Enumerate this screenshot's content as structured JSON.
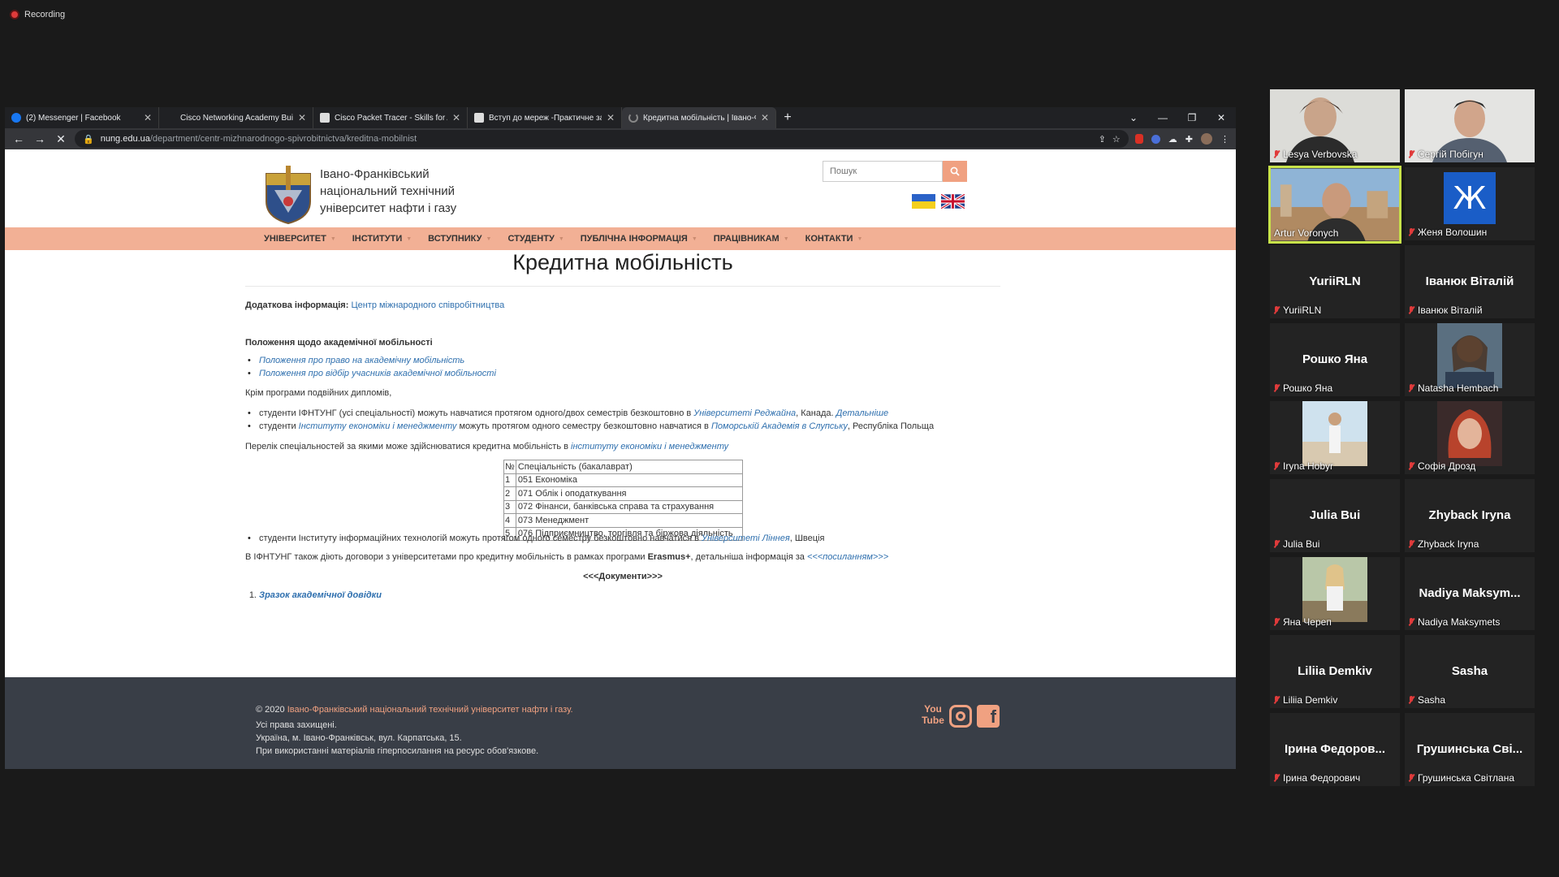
{
  "meeting": {
    "recording_label": "Recording"
  },
  "browser": {
    "tabs": [
      {
        "title": "(2) Messenger | Facebook"
      },
      {
        "title": "Cisco Networking Academy Builds"
      },
      {
        "title": "Cisco Packet Tracer - Skills for All"
      },
      {
        "title": "Вступ до мереж -Практичне за"
      },
      {
        "title": "Кредитна мобільність | Івано-Ф"
      }
    ],
    "url_host": "nung.edu.ua",
    "url_path": "/department/centr-mizhnarodnogo-spivrobitnictva/kreditna-mobilnist"
  },
  "site": {
    "name_line1": "Івано-Франківський",
    "name_line2": "національний технічний",
    "name_line3": "університет нафти і газу",
    "search_placeholder": "Пошук",
    "nav": [
      "УНІВЕРСИТЕТ",
      "ІНСТИТУТИ",
      "ВСТУПНИКУ",
      "СТУДЕНТУ",
      "ПУБЛІЧНА ІНФОРМАЦІЯ",
      "ПРАЦІВНИКАМ",
      "КОНТАКТИ"
    ]
  },
  "content": {
    "title": "Кредитна мобільність",
    "extra_label": "Додаткова інформація:",
    "extra_link": "Центр міжнародного співробітництва",
    "section_title": "Положення щодо академічної мобільності",
    "regulations": [
      "Положення про право на академічну мобільність",
      "Положення про відбір учасників академічної мобільності"
    ],
    "paragraph1": "Крім програми подвійних дипломів,",
    "program1": {
      "text1": "студенти ІФНТУНГ (усі спеціальності) можуть навчатися протягом одного/двох семестрів безкоштовно в",
      "link1": "Університеті Реджайна",
      "text2": ", Канада.",
      "link2": "Детальніше"
    },
    "program2": {
      "text1": "студенти",
      "link1": "Інституту економіки і менеджменту",
      "text2": "можуть протягом одного семестру безкоштовно навчатися в",
      "link2": "Поморській Академія в Слупську",
      "text3": ", Республіка Польща"
    },
    "paragraph2": {
      "text": "Перелік спеціальностей за якими може здійснюватися кредитна мобільність в",
      "link": "інституту економіки і менеджменту"
    },
    "table": {
      "headers": [
        "№",
        "Спеціальність (бакалаврат)"
      ],
      "rows": [
        [
          "1",
          "051 Економіка"
        ],
        [
          "2",
          "071 Облік і оподаткування"
        ],
        [
          "3",
          "072 Фінанси, банківська справа та страхування"
        ],
        [
          "4",
          "073 Менеджмент"
        ],
        [
          "5",
          "076 Підприємництво, торгівля та біржова діяльність"
        ]
      ]
    },
    "program3": {
      "text1": "студенти Інституту інформаційних технологій можуть протягом одного семестру безкоштовно навчатися в",
      "link": "Університеті Ліннея",
      "text2": ", Швеція"
    },
    "paragraph3": {
      "text1": "В ІФНТУНГ також діють договори з університетами про кредитну мобільність в рамках програми",
      "bold": "Erasmus+",
      "text2": ", детальніша інформація за",
      "link": "<<<посиланням>>>"
    },
    "docs_heading": "<<<Документи>>>",
    "docs": [
      {
        "num": "1.",
        "label": "Зразок академічної довідки"
      }
    ]
  },
  "footer": {
    "copyright_prefix": "© 2020 ",
    "copyright_link": "Івано-Франківський національний технічний університет нафти і газу.",
    "line1": "Усі права захищені.",
    "line2": "Україна, м. Івано-Франківськ, вул. Карпатська, 15.",
    "line3": "При використанні матеріалів гіперпосилання на ресурс обов'язкове."
  },
  "participants": [
    {
      "name": "Lesya Verbovska"
    },
    {
      "name": "Сергій Побігун"
    },
    {
      "name": "Artur Voronych"
    },
    {
      "name": "Женя Волошин",
      "avatar_letter": "Ж"
    },
    {
      "name": "YuriiRLN",
      "display": "YuriiRLN"
    },
    {
      "name": "Іванюк Віталій",
      "display": "Іванюк Віталій"
    },
    {
      "name": "Рошко Яна",
      "display": "Рошко Яна"
    },
    {
      "name": "Natasha Hembach"
    },
    {
      "name": "Iryna Hobyr"
    },
    {
      "name": "Софія Дрозд"
    },
    {
      "name": "Julia Bui",
      "display": "Julia Bui"
    },
    {
      "name": "Zhyback Iryna",
      "display": "Zhyback Iryna"
    },
    {
      "name": "Яна Череп"
    },
    {
      "name": "Nadiya Maksymets",
      "display": "Nadiya Maksym..."
    },
    {
      "name": "Liliia Demkiv",
      "display": "Liliia Demkiv"
    },
    {
      "name": "Sasha",
      "display": "Sasha"
    },
    {
      "name": "Ірина Федорович",
      "display": "Ірина Федоров..."
    },
    {
      "name": "Грушинська Світлана",
      "display": "Грушинська Сві..."
    }
  ],
  "colors": {
    "nav_bar": "#f2b095",
    "link": "#2e6fae",
    "footer_bg": "#393e47",
    "accent": "#f0a181",
    "active_speaker_border": "#c8e34a"
  }
}
